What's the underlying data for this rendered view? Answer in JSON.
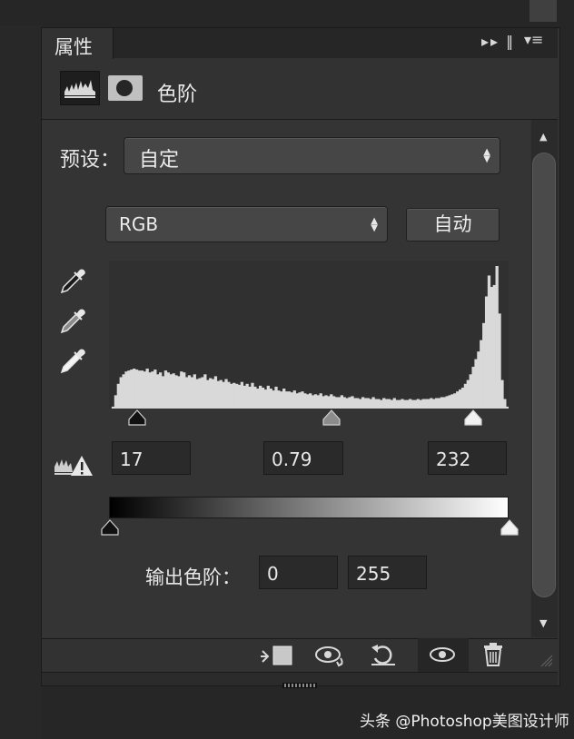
{
  "panel": {
    "tab_label": "属性",
    "tab_controls": "▸▸ ‖",
    "tab_menu": "▾≡"
  },
  "adjustment": {
    "title": "色阶",
    "levels_icon": "levels-histogram-icon",
    "mask_icon": "layer-mask-icon"
  },
  "preset": {
    "label": "预设：",
    "value": "自定"
  },
  "channel": {
    "value": "RGB"
  },
  "auto_button": "自动",
  "input_levels": {
    "shadow": "17",
    "midtone": "0.79",
    "highlight": "232"
  },
  "output_levels": {
    "label": "输出色阶：",
    "low": "0",
    "high": "255"
  },
  "histogram_data": {
    "type": "histogram",
    "bins": [
      0,
      2,
      14,
      26,
      33,
      36,
      39,
      40,
      41,
      42,
      41,
      40,
      40,
      39,
      42,
      38,
      39,
      41,
      36,
      38,
      34,
      40,
      38,
      36,
      37,
      35,
      34,
      39,
      38,
      33,
      35,
      33,
      36,
      31,
      32,
      33,
      36,
      30,
      32,
      31,
      34,
      29,
      30,
      28,
      31,
      28,
      26,
      27,
      26,
      25,
      28,
      24,
      26,
      23,
      27,
      23,
      21,
      24,
      22,
      20,
      24,
      21,
      19,
      23,
      19,
      18,
      21,
      18,
      18,
      17,
      19,
      16,
      17,
      18,
      16,
      15,
      16,
      14,
      15,
      14,
      16,
      13,
      14,
      13,
      15,
      13,
      12,
      12,
      14,
      12,
      11,
      12,
      13,
      11,
      11,
      10,
      12,
      11,
      11,
      10,
      12,
      10,
      10,
      9,
      11,
      10,
      10,
      9,
      11,
      9,
      9,
      10,
      9,
      9,
      10,
      9,
      9,
      10,
      9,
      10,
      10,
      10,
      11,
      10,
      11,
      11,
      12,
      12,
      13,
      14,
      15,
      16,
      18,
      20,
      22,
      26,
      30,
      36,
      44,
      52,
      60,
      72,
      90,
      118,
      140,
      128,
      130,
      150,
      100,
      30,
      10,
      2
    ]
  },
  "bottom_toolbar": {
    "icons": [
      "clip-to-layer-icon",
      "view-previous-state-icon",
      "reset-icon",
      "visibility-eye-icon",
      "delete-trash-icon"
    ]
  },
  "watermark": "头条 @Photoshop美图设计师"
}
